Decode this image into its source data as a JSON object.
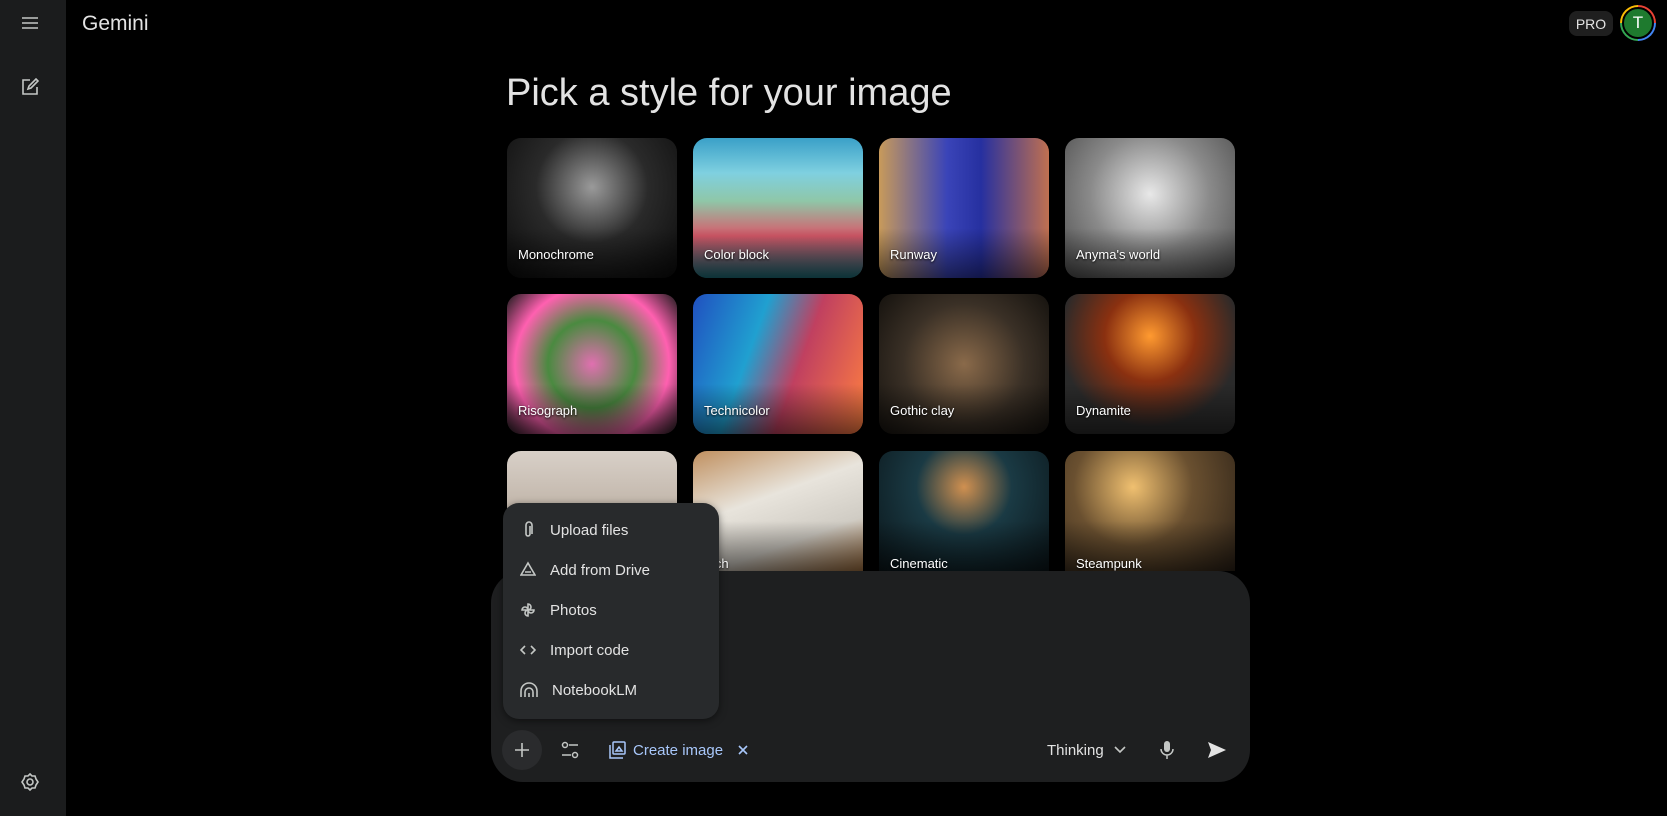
{
  "app": {
    "title": "Gemini",
    "badge": "PRO",
    "avatar_initial": "T"
  },
  "sidebar": {
    "icons": [
      "menu-icon",
      "new-chat-icon",
      "settings-icon"
    ]
  },
  "main": {
    "heading": "Pick a style for your image",
    "styles": [
      {
        "label": "Monochrome"
      },
      {
        "label": "Color block"
      },
      {
        "label": "Runway"
      },
      {
        "label": "Anyma's world"
      },
      {
        "label": "Risograph"
      },
      {
        "label": "Technicolor"
      },
      {
        "label": "Gothic clay"
      },
      {
        "label": "Dynamite"
      },
      {
        "label": ""
      },
      {
        "label": "etch"
      },
      {
        "label": "Cinematic"
      },
      {
        "label": "Steampunk"
      }
    ]
  },
  "menu": {
    "items": [
      {
        "label": "Upload files",
        "icon": "paperclip-icon"
      },
      {
        "label": "Add from Drive",
        "icon": "drive-icon"
      },
      {
        "label": "Photos",
        "icon": "photos-icon"
      },
      {
        "label": "Import code",
        "icon": "code-icon"
      },
      {
        "label": "NotebookLM",
        "icon": "notebooklm-icon"
      }
    ]
  },
  "composer": {
    "tool_chip": "Create image",
    "model": "Thinking",
    "accent": "#a8c7fa"
  }
}
